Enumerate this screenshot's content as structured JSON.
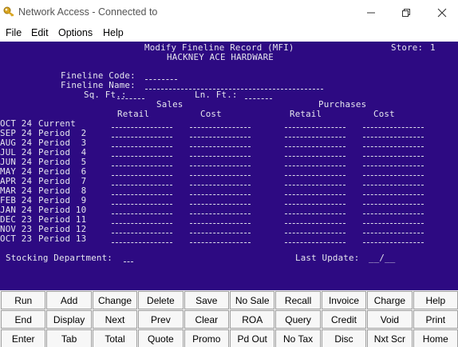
{
  "window": {
    "title": "Network Access - Connected to"
  },
  "menu": [
    "File",
    "Edit",
    "Options",
    "Help"
  ],
  "screen": {
    "heading": "Modify Fineline Record (MFI)",
    "store_label": "Store:",
    "store_value": "1",
    "company": "HACKNEY ACE HARDWARE",
    "fineline_code_label": "Fineline Code:",
    "fineline_name_label": "Fineline Name:",
    "sqft_label": "Sq. Ft.:",
    "lnft_label": "Ln. Ft.:",
    "sales_header": "Sales",
    "purchases_header": "Purchases",
    "col_retail": "Retail",
    "col_cost": "Cost",
    "periods": [
      {
        "month": "OCT 24",
        "label": "Current"
      },
      {
        "month": "SEP 24",
        "label": "Period  2"
      },
      {
        "month": "AUG 24",
        "label": "Period  3"
      },
      {
        "month": "JUL 24",
        "label": "Period  4"
      },
      {
        "month": "JUN 24",
        "label": "Period  5"
      },
      {
        "month": "MAY 24",
        "label": "Period  6"
      },
      {
        "month": "APR 24",
        "label": "Period  7"
      },
      {
        "month": "MAR 24",
        "label": "Period  8"
      },
      {
        "month": "FEB 24",
        "label": "Period  9"
      },
      {
        "month": "JAN 24",
        "label": "Period 10"
      },
      {
        "month": "DEC 23",
        "label": "Period 11"
      },
      {
        "month": "NOV 23",
        "label": "Period 12"
      },
      {
        "month": "OCT 23",
        "label": "Period 13"
      }
    ],
    "stocking_dept_label": "Stocking Department:",
    "last_update_label": "Last Update:",
    "last_update_value": "__/__"
  },
  "function_keys": [
    [
      "Run",
      "Add",
      "Change",
      "Delete",
      "Save",
      "No Sale",
      "Recall",
      "Invoice",
      "Charge",
      "Help"
    ],
    [
      "End",
      "Display",
      "Next",
      "Prev",
      "Clear",
      "ROA",
      "Query",
      "Credit",
      "Void",
      "Print"
    ],
    [
      "Enter",
      "Tab",
      "Total",
      "Quote",
      "Promo",
      "Pd Out",
      "No Tax",
      "Disc",
      "Nxt Scr",
      "Home"
    ]
  ]
}
